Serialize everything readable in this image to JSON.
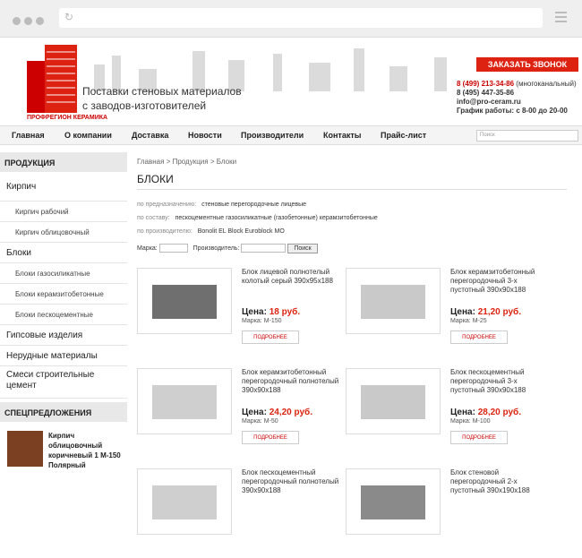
{
  "site": {
    "logo_text": "ПРОФРЕГИОН КЕРАМИКА",
    "tagline_1": "Поставки стеновых материалов",
    "tagline_2": "с заводов-изготовителей",
    "call_button": "ЗАКАЗАТЬ ЗВОНОК",
    "phone_1": "8 (499) 213-34-86",
    "phone_1_note": "(многоканальный)",
    "phone_2": "8 (495) 447-35-86",
    "email": "info@pro-ceram.ru",
    "schedule": "График работы: с 8-00 до 20-00"
  },
  "nav": {
    "items": [
      "Главная",
      "О компании",
      "Доставка",
      "Новости",
      "Производители",
      "Контакты",
      "Прайс-лист"
    ],
    "search_placeholder": "Поиск"
  },
  "sidebar": {
    "products_title": "ПРОДУКЦИЯ",
    "items": [
      {
        "label": "Кирпич"
      },
      {
        "label": "Кирпич рабочий"
      },
      {
        "label": "Кирпич облицовочный"
      },
      {
        "label": "Блоки"
      },
      {
        "label": "Блоки газосиликатные"
      },
      {
        "label": "Блоки керамзитобетонные"
      },
      {
        "label": "Блоки пескоцементные"
      },
      {
        "label": "Гипсовые изделия"
      },
      {
        "label": "Нерудные материалы"
      },
      {
        "label": "Смеси строительные цемент"
      }
    ],
    "offers_title": "СПЕЦПРЕДЛОЖЕНИЯ",
    "offer": "Кирпич облицовочный коричневый 1 М-150 Полярный"
  },
  "content": {
    "breadcrumb": "Главная > Продукция > Блоки",
    "title": "БЛОКИ",
    "filters": {
      "purpose_label": "по предназначению:",
      "purpose": [
        "стеновые",
        "перегородочные",
        "лицевые"
      ],
      "composition_label": "по составу:",
      "composition": [
        "пескоцементные",
        "газосиликатные (газобетонные)",
        "керамзитобетонные"
      ],
      "maker_label": "по производителю:",
      "maker": [
        "Bonolit",
        "EL Block",
        "Euroblock",
        "МО"
      ]
    },
    "marka_label": "Марка:",
    "producer_label": "Производитель:",
    "search_button": "Поиск",
    "products": [
      {
        "title": "Блок лицевой полнотелый колотый серый 390х95х188",
        "price_label": "Цена:",
        "price": "18 руб.",
        "mark": "Марка: М-150",
        "button": "ПОДРОБНЕЕ"
      },
      {
        "title": "Блок керамзитобетонный перегородочный 3-х пустотный 390х90х188",
        "price_label": "Цена:",
        "price": "21,20 руб.",
        "mark": "Марка: М-25",
        "button": "ПОДРОБНЕЕ"
      },
      {
        "title": "Блок керамзитобетонный перегородочный полнотелый 390х90х188",
        "price_label": "Цена:",
        "price": "24,20 руб.",
        "mark": "Марка: М-50",
        "button": "ПОДРОБНЕЕ"
      },
      {
        "title": "Блок пескоцементный перегородочный 3-х пустотный 390х90х188",
        "price_label": "Цена:",
        "price": "28,20 руб.",
        "mark": "Марка: М-100",
        "button": "ПОДРОБНЕЕ"
      },
      {
        "title": "Блок пескоцементный перегородочный полнотелый 390х90х188",
        "price_label": "",
        "price": "",
        "mark": "",
        "button": ""
      },
      {
        "title": "Блок стеновой перегородочный 2-х пустотный 390х190х188",
        "price_label": "",
        "price": "",
        "mark": "",
        "button": ""
      }
    ]
  }
}
